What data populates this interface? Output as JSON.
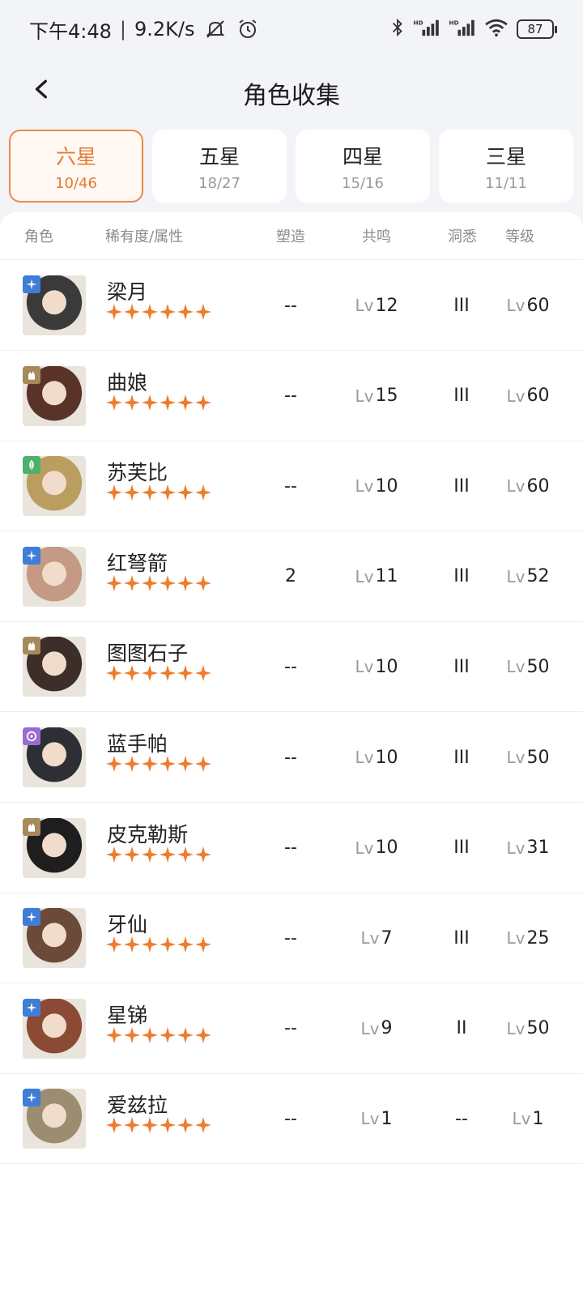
{
  "status": {
    "time": "下午4:48",
    "speed": "9.2K/s",
    "battery": "87"
  },
  "header": {
    "title": "角色收集"
  },
  "tabs": [
    {
      "label": "六星",
      "count": "10/46",
      "active": true
    },
    {
      "label": "五星",
      "count": "18/27",
      "active": false
    },
    {
      "label": "四星",
      "count": "15/16",
      "active": false
    },
    {
      "label": "三星",
      "count": "11/11",
      "active": false
    }
  ],
  "columns": {
    "role": "角色",
    "rarity": "稀有度/属性",
    "shape": "塑造",
    "resonance": "共鸣",
    "insight": "洞悉",
    "level": "等级"
  },
  "lv_prefix": "Lv",
  "stars_per_row": 6,
  "rows": [
    {
      "name": "梁月",
      "attr": "star",
      "attr_color": "#3f7ed6",
      "shape": "--",
      "resonance": "12",
      "insight": "III",
      "level": "60",
      "avatar_color": "#3a3a3a"
    },
    {
      "name": "曲娘",
      "attr": "beast",
      "attr_color": "#a68a5b",
      "shape": "--",
      "resonance": "15",
      "insight": "III",
      "level": "60",
      "avatar_color": "#5a3328"
    },
    {
      "name": "苏芙比",
      "attr": "plant",
      "attr_color": "#4fb06a",
      "shape": "--",
      "resonance": "10",
      "insight": "III",
      "level": "60",
      "avatar_color": "#b99e60"
    },
    {
      "name": "红弩箭",
      "attr": "star",
      "attr_color": "#3f7ed6",
      "shape": "2",
      "resonance": "11",
      "insight": "III",
      "level": "52",
      "avatar_color": "#c49a84"
    },
    {
      "name": "图图石子",
      "attr": "beast",
      "attr_color": "#a68a5b",
      "shape": "--",
      "resonance": "10",
      "insight": "III",
      "level": "50",
      "avatar_color": "#3d2e2a"
    },
    {
      "name": "蓝手帕",
      "attr": "spirit",
      "attr_color": "#9b6bd1",
      "shape": "--",
      "resonance": "10",
      "insight": "III",
      "level": "50",
      "avatar_color": "#2e2e35"
    },
    {
      "name": "皮克勒斯",
      "attr": "beast",
      "attr_color": "#a68a5b",
      "shape": "--",
      "resonance": "10",
      "insight": "III",
      "level": "31",
      "avatar_color": "#1e1e1e"
    },
    {
      "name": "牙仙",
      "attr": "star",
      "attr_color": "#3f7ed6",
      "shape": "--",
      "resonance": "7",
      "insight": "III",
      "level": "25",
      "avatar_color": "#6b4a3a"
    },
    {
      "name": "星锑",
      "attr": "star",
      "attr_color": "#3f7ed6",
      "shape": "--",
      "resonance": "9",
      "insight": "II",
      "level": "50",
      "avatar_color": "#8a4a33"
    },
    {
      "name": "爱兹拉",
      "attr": "star",
      "attr_color": "#3f7ed6",
      "shape": "--",
      "resonance": "1",
      "insight": "--",
      "level": "1",
      "avatar_color": "#9c8c70"
    }
  ],
  "colors": {
    "accent": "#e57a33",
    "star": "#ef7c2d"
  }
}
